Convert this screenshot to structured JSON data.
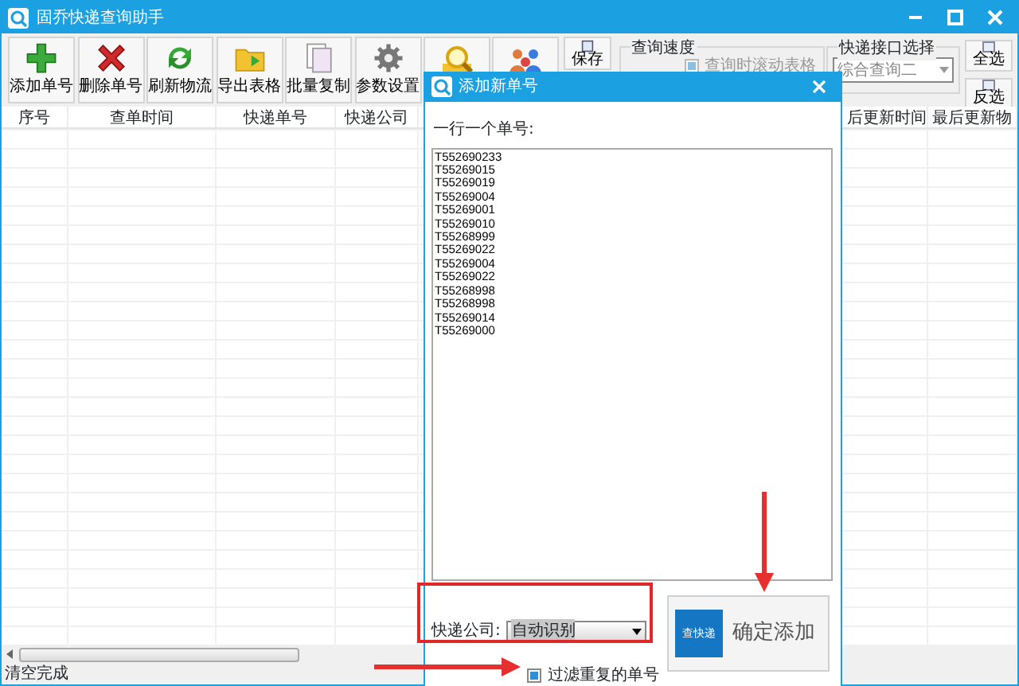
{
  "window": {
    "title": "固乔快递查询助手"
  },
  "toolbar": {
    "buttons": [
      {
        "label": "添加单号",
        "kind": "add"
      },
      {
        "label": "删除单号",
        "kind": "delete"
      },
      {
        "label": "刷新物流",
        "kind": "refresh"
      },
      {
        "label": "导出表格",
        "kind": "export"
      },
      {
        "label": "批量复制",
        "kind": "copy"
      },
      {
        "label": "参数设置",
        "kind": "settings"
      },
      {
        "kind": "search"
      },
      {
        "kind": "people"
      }
    ],
    "save_button": "保存",
    "speed_group": {
      "title": "查询速度",
      "checkbox": {
        "label": "查询时滚动表格",
        "checked": true,
        "disabled": true
      }
    },
    "api_group": {
      "title": "快递接口选择",
      "select": "综合查询二"
    },
    "side_buttons": [
      "全选",
      "反选"
    ]
  },
  "table": {
    "columns_left": [
      "序号",
      "查单时间",
      "快递单号",
      "快递公司"
    ],
    "columns_right": [
      "后更新时间",
      "最后更新物"
    ]
  },
  "status_bar": "清空完成",
  "dialog": {
    "title": "添加新单号",
    "prompt": "一行一个单号:",
    "numbers": [
      "T552690233",
      "T55269015",
      "T55269019",
      "T55269004",
      "T55269001",
      "T55269010",
      "T55268999",
      "T55269022",
      "T55269004",
      "T55269022",
      "T55268998",
      "T55268998",
      "T55269014",
      "T55269000"
    ],
    "company_label": "快递公司:",
    "company_select": "自动识别",
    "filter_checkbox": {
      "label": "过滤重复的单号",
      "checked": true
    },
    "confirm_button": {
      "icon_text": "查快递",
      "label": "确定添加"
    }
  }
}
